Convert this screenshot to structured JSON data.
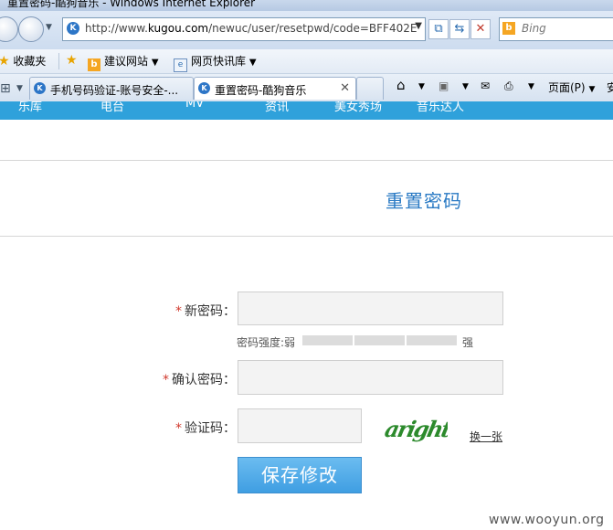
{
  "window": {
    "title": "重置密码-酷狗音乐 - Windows Internet Explorer"
  },
  "address": {
    "url_prefix": "http://www.",
    "url_domain": "kugou.com",
    "url_path": "/newuc/user/resetpwd/code=BFF402E",
    "search_placeholder": "Bing"
  },
  "favorites": {
    "favorites_label": "收藏夹",
    "suggested_label": "建议网站",
    "webslice_label": "网页快讯库"
  },
  "tabs": [
    {
      "label": "手机号码验证-账号安全-..."
    },
    {
      "label": "重置密码-酷狗音乐"
    }
  ],
  "commandbar": {
    "page_menu": "页面(P)",
    "safety_menu": "安"
  },
  "site_nav": [
    "乐库",
    "电台",
    "MV",
    "资讯",
    "美女秀场",
    "音乐达人"
  ],
  "page": {
    "heading": "重置密码",
    "form": {
      "new_password_label": "新密码：",
      "strength_label": "密码强度:弱",
      "strength_strong": "强",
      "strength_level": 0,
      "confirm_password_label": "确认密码：",
      "captcha_label": "验证码：",
      "captcha_text": "aright",
      "refresh_captcha": "换一张",
      "submit": "保存修改"
    }
  },
  "watermark": "www.wooyun.org",
  "colors": {
    "accent": "#2a7ac4",
    "nav_blue": "#2fa1db",
    "button": "#4aa8e8",
    "required": "#d0382c",
    "captcha": "#2c8a2c"
  }
}
